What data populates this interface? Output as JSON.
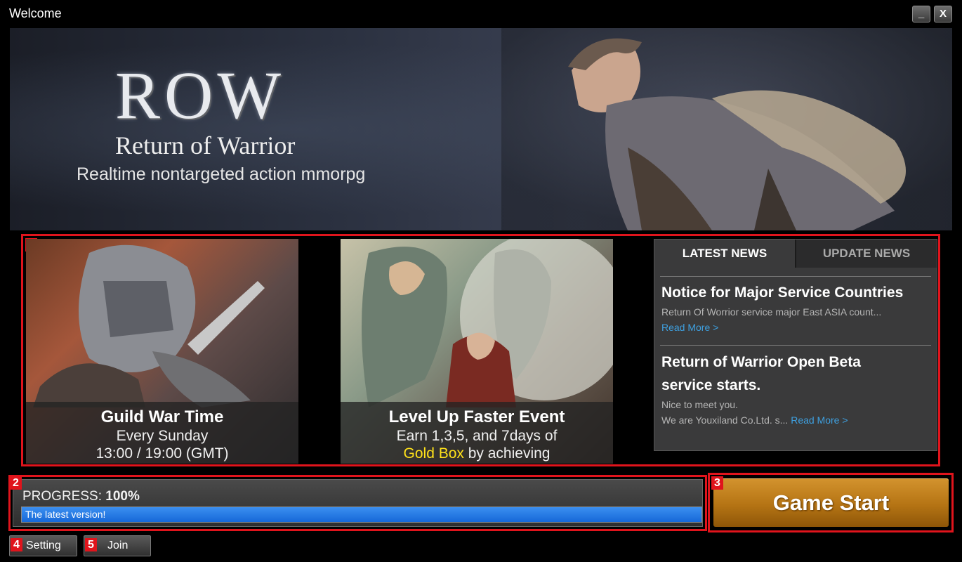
{
  "window": {
    "title": "Welcome",
    "minimize_label": "_",
    "close_label": "X"
  },
  "banner": {
    "logo": "ROW",
    "subtitle": "Return of Warrior",
    "tagline": "Realtime nontargeted action mmorpg"
  },
  "annotations": [
    "1",
    "2",
    "3",
    "4",
    "5"
  ],
  "events": [
    {
      "title": "Guild War Time",
      "line1": "Every Sunday",
      "line2": "13:00 / 19:00 (GMT)"
    },
    {
      "title": "Level Up Faster Event",
      "line1": "Earn 1,3,5, and 7days of",
      "line2_highlight": "Gold Box",
      "line2_rest": " by achieving"
    }
  ],
  "news": {
    "tabs": [
      "LATEST NEWS",
      "UPDATE NEWS"
    ],
    "items": [
      {
        "title": "Notice for Major Service Countries",
        "text": "Return Of Worrior service major East ASIA count...",
        "read_more": "Read More >"
      },
      {
        "title_line1": "Return of Warrior Open Beta",
        "title_line2": "service starts.",
        "text1": "Nice to meet you.",
        "text2": "We are Youxiland Co.Ltd. s...",
        "read_more": "Read More >"
      }
    ]
  },
  "progress": {
    "label": "PROGRESS:",
    "value_text": "100%",
    "fraction": 1.0,
    "status": "The latest version!"
  },
  "start_button": "Game Start",
  "buttons": {
    "setting": "Setting",
    "join": "Join"
  },
  "colors": {
    "annotation_red": "#e0141c",
    "progress_blue": "#1d74e4",
    "start_orange": "#b57414",
    "gold_text": "#ffe21a",
    "link_blue": "#3ea0e0"
  }
}
